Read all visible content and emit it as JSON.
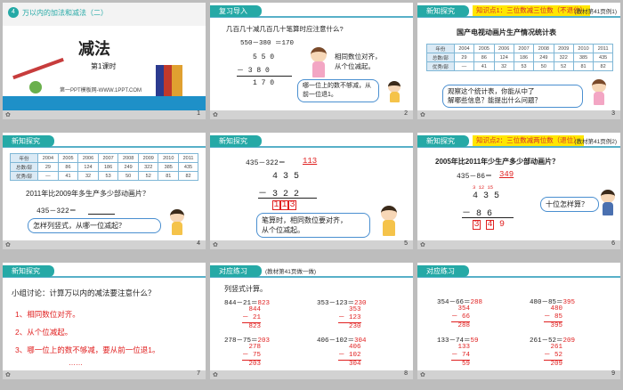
{
  "colors": {
    "teal": "#25a9a6",
    "red": "#e02020",
    "yellow": "#ffe600",
    "footer": "#d2d2d2"
  },
  "slide1": {
    "badge": "4",
    "unit_title": "万以内的加法和减法（二）",
    "title": "减法",
    "lesson": "第1课时",
    "website": "第一PPT模板网-WWW.1PPT.COM",
    "num": "1"
  },
  "slide2": {
    "tag": "复习导入",
    "q": "几百几十减几百几十笔算时应注意什么?",
    "eq": "550－380 ＝170",
    "r1": "5 5 0",
    "r2": "－  3 8 0",
    "r3": "1 7 0",
    "b1a": "相同数位对齐，",
    "b1b": "从个位减起。",
    "b2a": "哪一位上的数不够减，从",
    "b2b": "前一位退1。",
    "num": "2"
  },
  "slide3": {
    "tag": "新知探究",
    "kp": "知识点1：三位数减三位数（不退位）",
    "src": "(教材第41页例1)",
    "title": "国产电视动画片生产情况统计表",
    "years": [
      "年份",
      "2004",
      "2005",
      "2006",
      "2007",
      "2008",
      "2009",
      "2010",
      "2011"
    ],
    "total": [
      "总数/部",
      "29",
      "86",
      "124",
      "186",
      "249",
      "322",
      "385",
      "435"
    ],
    "good": [
      "优秀/部",
      "—",
      "41",
      "32",
      "53",
      "50",
      "52",
      "81",
      "82"
    ],
    "q1": "观察这个统计表，你能从中了",
    "q2": "解哪些信息？能提出什么问题？",
    "num": "3"
  },
  "slide4": {
    "tag": "新知探究",
    "years": [
      "年份",
      "2004",
      "2005",
      "2006",
      "2007",
      "2008",
      "2009",
      "2010",
      "2011"
    ],
    "total": [
      "总数/部",
      "29",
      "86",
      "124",
      "186",
      "249",
      "322",
      "385",
      "435"
    ],
    "good": [
      "优秀/部",
      "—",
      "41",
      "32",
      "53",
      "50",
      "52",
      "81",
      "82"
    ],
    "q": "2011年比2009年多生产多少部动画片？",
    "eq": "435－322＝",
    "ask": "怎样列竖式，从哪一位减起？",
    "num": "4"
  },
  "slide5": {
    "tag": "新知探究",
    "eq": "435－322＝",
    "ans": "113",
    "r1": "4 3 5",
    "r2": "－ 3 2 2",
    "d1": "1",
    "d2": "1",
    "d3": "3",
    "s1": "笔算时，相同数位要对齐，",
    "s2": "从个位减起。",
    "num": "5"
  },
  "slide6": {
    "tag": "新知探究",
    "kp": "知识点2：三位数减两位数（退位）",
    "src": "(教材第41页例2)",
    "q": "2005年比2011年少生产多少部动画片？",
    "eq": "435－86＝",
    "ans": "349",
    "dots": "3  12  15",
    "r1": "4  3  5",
    "r2": "－    8  6",
    "d1": "3",
    "d2": "4",
    "d3": "9",
    "ask": "十位怎样算？",
    "num": "6"
  },
  "slide7": {
    "tag": "新知探究",
    "title": "小组讨论：计算万以内的减法要注意什么？",
    "p1": "1、相同数位对齐。",
    "p2": "2、从个位减起。",
    "p3": "3、哪一位上的数不够减，要从前一位退1。",
    "p4": "……",
    "num": "7"
  },
  "slide8": {
    "tag": "对应练习",
    "src": "(教材第41页做一做)",
    "title": "列竖式计算。",
    "e1": "844－21＝",
    "a1": "823",
    "v1": [
      "844",
      "－  21",
      "823"
    ],
    "e2": "353－123＝",
    "a2": "230",
    "v2": [
      "353",
      "－ 123",
      "230"
    ],
    "e3": "278－75＝",
    "a3": "203",
    "v3": [
      "278",
      "－  75",
      "203"
    ],
    "e4": "406－102＝",
    "a4": "304",
    "v4": [
      "406",
      "－ 102",
      "304"
    ],
    "num": "8"
  },
  "slide9": {
    "tag": "对应练习",
    "e1": "354－66＝",
    "a1": "288",
    "v1": [
      "354",
      "－  66",
      "288"
    ],
    "e2": "480－85＝",
    "a2": "395",
    "v2": [
      "480",
      "－  85",
      "395"
    ],
    "e3": "133－74＝",
    "a3": "59",
    "v3": [
      "133",
      "－  74",
      "59"
    ],
    "e4": "261－52＝",
    "a4": "209",
    "v4": [
      "261",
      "－  52",
      "209"
    ],
    "num": "9"
  }
}
